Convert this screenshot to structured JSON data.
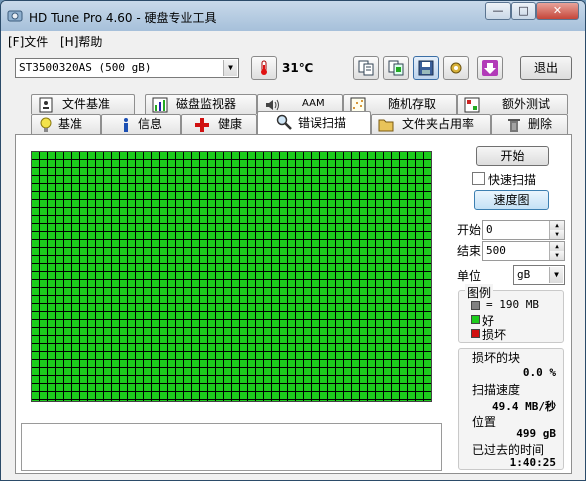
{
  "window": {
    "title": "HD Tune Pro 4.60 - 硬盘专业工具",
    "min": "—",
    "max": "□",
    "close": "✕"
  },
  "menu": [
    {
      "label": "[F]文件"
    },
    {
      "label": "[H]帮助"
    }
  ],
  "toolbar": {
    "drive": "ST3500320AS  (500 gB)",
    "temperature": "31℃",
    "exit": "退出"
  },
  "tabs_top": [
    {
      "label": "文件基准",
      "icon": "file-benchmark-icon"
    },
    {
      "label": "磁盘监视器",
      "icon": "disk-monitor-icon"
    },
    {
      "label": "AAM",
      "icon": "speaker-icon"
    },
    {
      "label": "随机存取",
      "icon": "random-access-icon"
    },
    {
      "label": "额外测试",
      "icon": "extra-tests-icon"
    }
  ],
  "tabs_bottom": [
    {
      "label": "基准",
      "icon": "lightbulb-icon"
    },
    {
      "label": "信息",
      "icon": "info-icon"
    },
    {
      "label": "健康",
      "icon": "health-cross-icon"
    },
    {
      "label": "错误扫描",
      "icon": "magnifier-icon"
    },
    {
      "label": "文件夹占用率",
      "icon": "folder-icon"
    },
    {
      "label": "删除",
      "icon": "trash-icon"
    }
  ],
  "scan": {
    "start_button": "开始",
    "quick_scan_label": "快速扫描",
    "quick_scan_checked": false,
    "speed_map_button": "速度图",
    "start_label": "开始",
    "start_value": "0",
    "end_label": "结束",
    "end_value": "500",
    "unit_label": "单位",
    "unit_value": "gB",
    "legend_title": "图例",
    "legend_block": "= 190 MB",
    "legend_good": "好",
    "legend_bad": "损坏",
    "colors": {
      "good": "#1ccc1c",
      "bad": "#d01010",
      "block": "#808080"
    },
    "stats": {
      "damaged_label": "损坏的块",
      "damaged_value": "0.0 %",
      "speed_label": "扫描速度",
      "speed_value": "49.4 MB/秒",
      "position_label": "位置",
      "position_value": "499 gB",
      "elapsed_label": "已过去的时间",
      "elapsed_value": "1:40:25"
    }
  }
}
